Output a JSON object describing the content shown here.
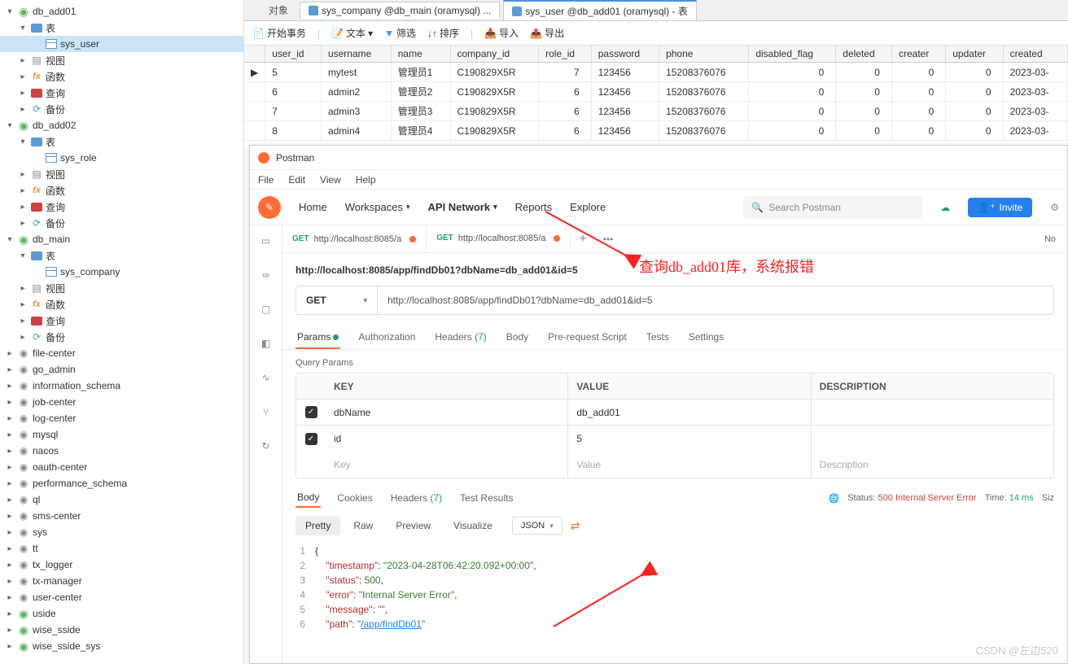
{
  "tree": {
    "db_add01": {
      "name": "db_add01",
      "tables": [
        "sys_user"
      ],
      "nodes": [
        "表",
        "视图",
        "函数",
        "查询",
        "备份"
      ]
    },
    "db_add02": {
      "name": "db_add02",
      "tables": [
        "sys_role"
      ],
      "nodes": [
        "表",
        "视图",
        "函数",
        "查询",
        "备份"
      ]
    },
    "db_main": {
      "name": "db_main",
      "tables": [
        "sys_company"
      ],
      "nodes": [
        "表",
        "视图",
        "函数",
        "查询",
        "备份"
      ]
    },
    "others": [
      "file-center",
      "go_admin",
      "information_schema",
      "job-center",
      "log-center",
      "mysql",
      "nacos",
      "oauth-center",
      "performance_schema",
      "ql",
      "sms-center",
      "sys",
      "tt",
      "tx_logger",
      "tx-manager",
      "user-center",
      "uside",
      "wise_sside",
      "wise_sside_sys"
    ]
  },
  "tabs": {
    "obj": "对象",
    "t1": "sys_company @db_main (oramysql) ...",
    "t2": "sys_user @db_add01 (oramysql) - 表"
  },
  "toolbar": {
    "begin": "开始事务",
    "text": "文本",
    "filter": "筛选",
    "sort": "排序",
    "import": "导入",
    "export": "导出"
  },
  "grid": {
    "cols": [
      "user_id",
      "username",
      "name",
      "company_id",
      "role_id",
      "password",
      "phone",
      "disabled_flag",
      "deleted",
      "creater",
      "updater",
      "created"
    ],
    "rows": [
      {
        "user_id": "5",
        "username": "mytest",
        "name": "管理员1",
        "company_id": "C190829X5R",
        "role_id": "7",
        "password": "123456",
        "phone": "15208376076",
        "disabled_flag": "0",
        "deleted": "0",
        "creater": "0",
        "updater": "0",
        "created": "2023-03-"
      },
      {
        "user_id": "6",
        "username": "admin2",
        "name": "管理员2",
        "company_id": "C190829X5R",
        "role_id": "6",
        "password": "123456",
        "phone": "15208376076",
        "disabled_flag": "0",
        "deleted": "0",
        "creater": "0",
        "updater": "0",
        "created": "2023-03-"
      },
      {
        "user_id": "7",
        "username": "admin3",
        "name": "管理员3",
        "company_id": "C190829X5R",
        "role_id": "6",
        "password": "123456",
        "phone": "15208376076",
        "disabled_flag": "0",
        "deleted": "0",
        "creater": "0",
        "updater": "0",
        "created": "2023-03-"
      },
      {
        "user_id": "8",
        "username": "admin4",
        "name": "管理员4",
        "company_id": "C190829X5R",
        "role_id": "6",
        "password": "123456",
        "phone": "15208376076",
        "disabled_flag": "0",
        "deleted": "0",
        "creater": "0",
        "updater": "0",
        "created": "2023-03-"
      }
    ]
  },
  "postman": {
    "title": "Postman",
    "menu": [
      "File",
      "Edit",
      "View",
      "Help"
    ],
    "nav": {
      "home": "Home",
      "workspaces": "Workspaces",
      "api": "API Network",
      "reports": "Reports",
      "explore": "Explore",
      "search_ph": "Search Postman",
      "invite": "Invite"
    },
    "tabs": {
      "t1": "http://localhost:8085/a",
      "t2": "http://localhost:8085/a",
      "noenv": "No"
    },
    "url_title": "http://localhost:8085/app/findDb01?dbName=db_add01&id=5",
    "method": "GET",
    "url": "http://localhost:8085/app/findDb01?dbName=db_add01&id=5",
    "reqtabs": {
      "params": "Params",
      "auth": "Authorization",
      "headers": "Headers",
      "headers_n": "(7)",
      "body": "Body",
      "pre": "Pre-request Script",
      "tests": "Tests",
      "settings": "Settings"
    },
    "query_title": "Query Params",
    "qhead": {
      "key": "KEY",
      "value": "VALUE",
      "desc": "DESCRIPTION"
    },
    "qrows": [
      {
        "k": "dbName",
        "v": "db_add01"
      },
      {
        "k": "id",
        "v": "5"
      }
    ],
    "qph": {
      "key": "Key",
      "value": "Value",
      "desc": "Description"
    },
    "resptabs": {
      "body": "Body",
      "cookies": "Cookies",
      "headers": "Headers",
      "headers_n": "(7)",
      "tests": "Test Results"
    },
    "status": {
      "label": "Status:",
      "code": "500 Internal Server Error",
      "time_label": "Time:",
      "time": "14 ms",
      "size_label": "Siz"
    },
    "viewbar": {
      "pretty": "Pretty",
      "raw": "Raw",
      "preview": "Preview",
      "visualize": "Visualize",
      "json": "JSON"
    },
    "json": {
      "timestamp": "2023-04-28T06:42:20.092+00:00",
      "status": "500",
      "error": "Internal Server Error",
      "message": "",
      "path": "/app/findDb01"
    }
  },
  "annotation": "查询db_add01库，系统报错",
  "watermark": "CSDN @左边520"
}
